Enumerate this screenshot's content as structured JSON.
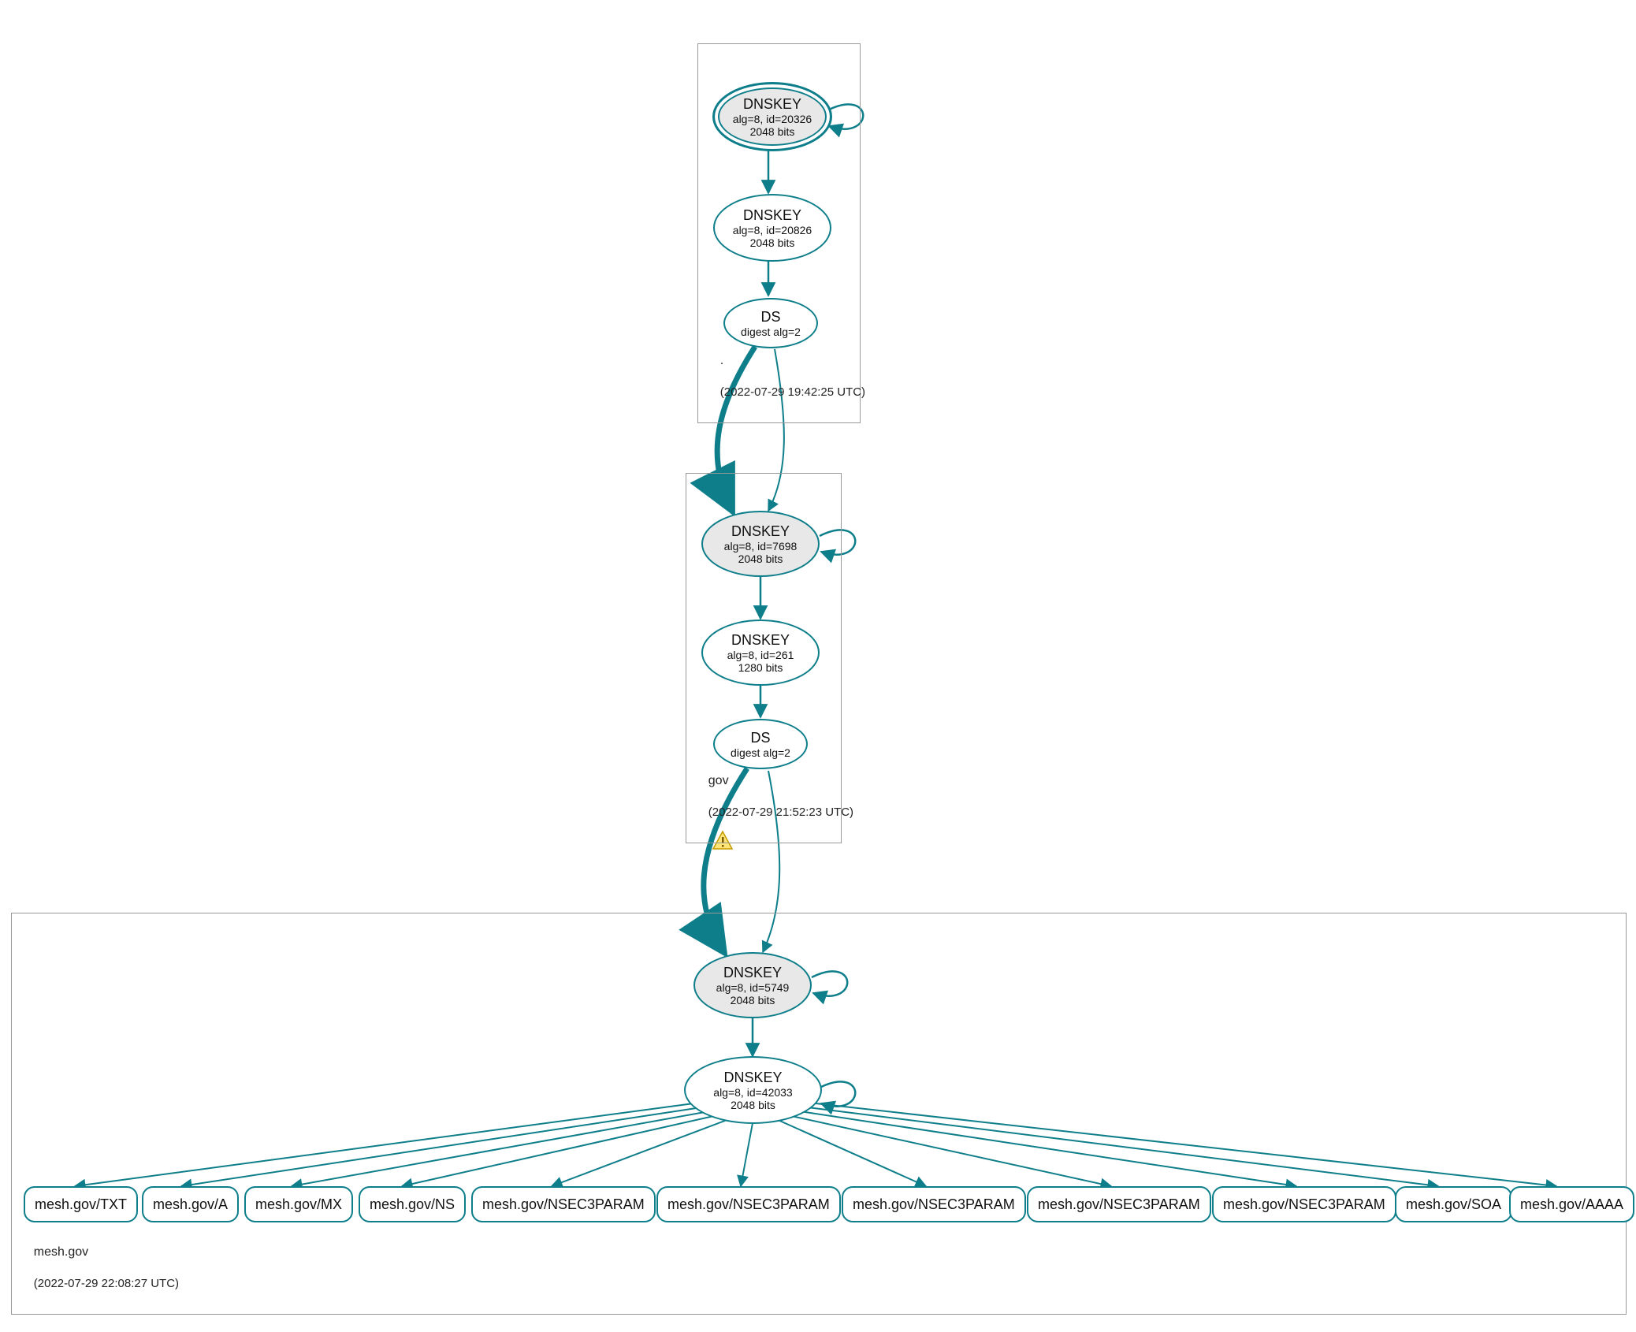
{
  "colors": {
    "stroke": "#0d7e8a",
    "zone_border": "#999999",
    "text": "#111111",
    "ksk_fill": "#e8e8e8"
  },
  "zones": {
    "root": {
      "label": ".",
      "timestamp": "(2022-07-29 19:42:25 UTC)"
    },
    "gov": {
      "label": "gov",
      "timestamp": "(2022-07-29 21:52:23 UTC)"
    },
    "mesh": {
      "label": "mesh.gov",
      "timestamp": "(2022-07-29 22:08:27 UTC)"
    }
  },
  "nodes": {
    "root_ksk": {
      "type": "DNSKEY",
      "line2": "alg=8, id=20326",
      "line3": "2048 bits"
    },
    "root_zsk": {
      "type": "DNSKEY",
      "line2": "alg=8, id=20826",
      "line3": "2048 bits"
    },
    "root_ds": {
      "type": "DS",
      "line2": "digest alg=2"
    },
    "gov_ksk": {
      "type": "DNSKEY",
      "line2": "alg=8, id=7698",
      "line3": "2048 bits"
    },
    "gov_zsk": {
      "type": "DNSKEY",
      "line2": "alg=8, id=261",
      "line3": "1280 bits"
    },
    "gov_ds": {
      "type": "DS",
      "line2": "digest alg=2"
    },
    "mesh_ksk": {
      "type": "DNSKEY",
      "line2": "alg=8, id=5749",
      "line3": "2048 bits"
    },
    "mesh_zsk": {
      "type": "DNSKEY",
      "line2": "alg=8, id=42033",
      "line3": "2048 bits"
    },
    "rr0": {
      "label": "mesh.gov/TXT"
    },
    "rr1": {
      "label": "mesh.gov/A"
    },
    "rr2": {
      "label": "mesh.gov/MX"
    },
    "rr3": {
      "label": "mesh.gov/NS"
    },
    "rr4": {
      "label": "mesh.gov/NSEC3PARAM"
    },
    "rr5": {
      "label": "mesh.gov/NSEC3PARAM"
    },
    "rr6": {
      "label": "mesh.gov/NSEC3PARAM"
    },
    "rr7": {
      "label": "mesh.gov/NSEC3PARAM"
    },
    "rr8": {
      "label": "mesh.gov/NSEC3PARAM"
    },
    "rr9": {
      "label": "mesh.gov/SOA"
    },
    "rr10": {
      "label": "mesh.gov/AAAA"
    }
  },
  "edges": [
    {
      "from": "root_ksk",
      "to": "root_ksk",
      "self": true
    },
    {
      "from": "root_ksk",
      "to": "root_zsk"
    },
    {
      "from": "root_zsk",
      "to": "root_ds"
    },
    {
      "from": "root_ds",
      "to": "gov_ksk",
      "thick": true,
      "curve": "left"
    },
    {
      "from": "root_ds",
      "to": "gov_ksk",
      "curve": "right"
    },
    {
      "from": "gov_ksk",
      "to": "gov_ksk",
      "self": true
    },
    {
      "from": "gov_ksk",
      "to": "gov_zsk"
    },
    {
      "from": "gov_zsk",
      "to": "gov_ds"
    },
    {
      "from": "gov_ds",
      "to": "mesh_ksk",
      "thick": true,
      "curve": "left",
      "warning": true
    },
    {
      "from": "gov_ds",
      "to": "mesh_ksk",
      "curve": "right"
    },
    {
      "from": "mesh_ksk",
      "to": "mesh_ksk",
      "self": true
    },
    {
      "from": "mesh_ksk",
      "to": "mesh_zsk"
    },
    {
      "from": "mesh_zsk",
      "to": "mesh_zsk",
      "self": true
    },
    {
      "from": "mesh_zsk",
      "to": "rr0"
    },
    {
      "from": "mesh_zsk",
      "to": "rr1"
    },
    {
      "from": "mesh_zsk",
      "to": "rr2"
    },
    {
      "from": "mesh_zsk",
      "to": "rr3"
    },
    {
      "from": "mesh_zsk",
      "to": "rr4"
    },
    {
      "from": "mesh_zsk",
      "to": "rr5"
    },
    {
      "from": "mesh_zsk",
      "to": "rr6"
    },
    {
      "from": "mesh_zsk",
      "to": "rr7"
    },
    {
      "from": "mesh_zsk",
      "to": "rr8"
    },
    {
      "from": "mesh_zsk",
      "to": "rr9"
    },
    {
      "from": "mesh_zsk",
      "to": "rr10"
    }
  ]
}
